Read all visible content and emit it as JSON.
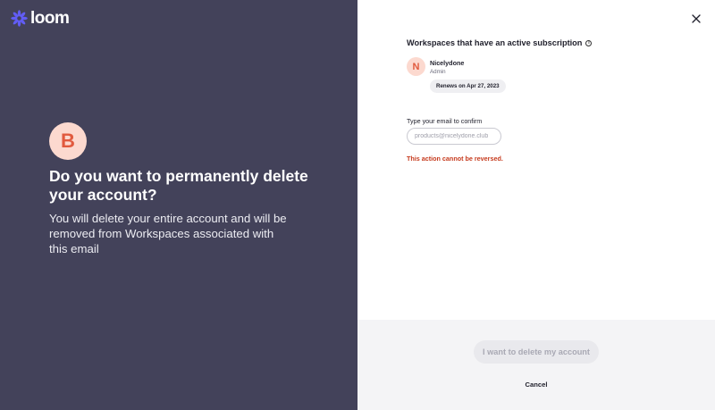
{
  "brand": {
    "name": "loom",
    "color": "#625df5"
  },
  "left_panel": {
    "avatar_letter": "B",
    "title": "Do you want to permanently delete your account?",
    "description": "You will delete your entire account and will be removed from Workspaces associated with this email",
    "background": "#43425a"
  },
  "workspaces": {
    "heading": "Workspaces that have an active subscription",
    "items": [
      {
        "avatar_letter": "N",
        "name": "Nicelydone",
        "role": "Admin",
        "renewal": "Renews on Apr 27, 2023"
      }
    ]
  },
  "confirm": {
    "label": "Type your email to confirm",
    "placeholder": "products@nicelydone.club",
    "value": "",
    "warning": "This action cannot be reversed."
  },
  "actions": {
    "delete_label": "I want to delete my account",
    "cancel_label": "Cancel"
  },
  "icons": {
    "close": "close-icon",
    "info": "info-icon",
    "logo": "loom-logo-icon"
  },
  "colors": {
    "warning": "#c63b1e",
    "avatar_bg": "#fcd9cf",
    "avatar_fg": "#e15a3e"
  }
}
